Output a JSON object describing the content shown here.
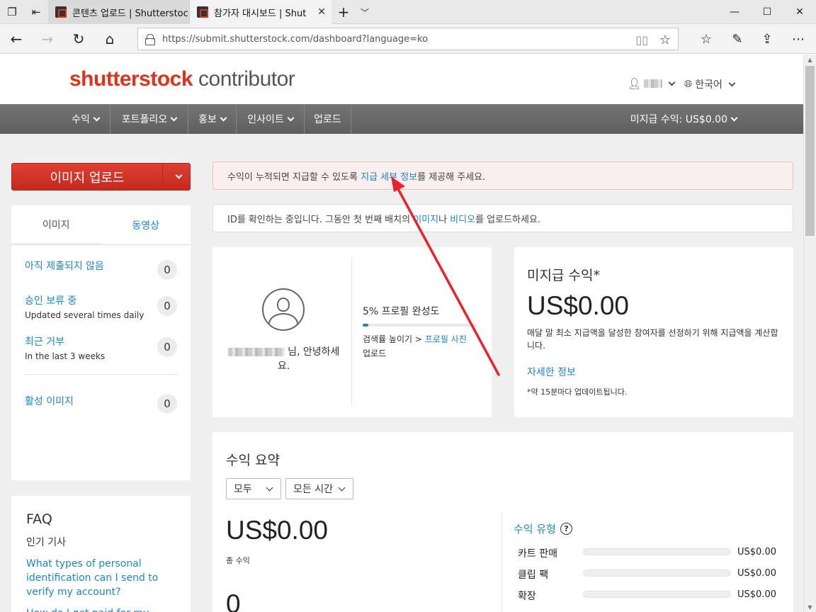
{
  "browser": {
    "tabs": [
      {
        "title": "콘텐츠 업로드 | Shutterstoc",
        "active": false
      },
      {
        "title": "참가자 대시보드 | Shut",
        "active": true
      }
    ],
    "url": "https://submit.shutterstock.com/dashboard?language=ko"
  },
  "header": {
    "logo_brand": "shutterstock",
    "logo_sub": "contributor",
    "language": "한국어"
  },
  "nav": {
    "items": [
      "수익",
      "포트폴리오",
      "홍보",
      "인사이트",
      "업로드"
    ],
    "unpaid": "미지급 수익: US$0.00"
  },
  "upload_button": "이미지 업로드",
  "left_card": {
    "tabs": [
      "이미지",
      "동영상"
    ],
    "rows": [
      {
        "title": "아직 제출되지 않음",
        "subtitle": "",
        "count": "0"
      },
      {
        "title": "승인 보류 중",
        "subtitle": "Updated several times daily",
        "count": "0"
      },
      {
        "title": "최근 거부",
        "subtitle": "In the last 3 weeks",
        "count": "0"
      },
      {
        "title": "활성 이미지",
        "subtitle": "",
        "count": "0"
      }
    ]
  },
  "faq": {
    "title": "FAQ",
    "subtitle": "인기 기사",
    "links": [
      "What types of personal identification can I send to verify my account?",
      "How do I get paid for my work?"
    ]
  },
  "alerts": {
    "payment_pre": "수익이 누적되면 지급할 수 있도록 ",
    "payment_link": "지급 세부 정보",
    "payment_post": "를 제공해 주세요.",
    "id_pre": "ID를 확인하는 중입니다. 그동안 첫 번째 배치의 ",
    "id_link1": "이미지",
    "id_mid": "나 ",
    "id_link2": "비디오",
    "id_post": "를 업로드하세요."
  },
  "profile": {
    "greeting": "님, 안녕하세요.",
    "completion_title": "5% 프로필 완성도",
    "completion_pct": 5,
    "hint_pre": "검색률 높이기 > ",
    "hint_link": "프로필 사진",
    "hint_post": "업로드"
  },
  "unpaid_card": {
    "title": "미지급 수익*",
    "amount": "US$0.00",
    "desc": "매달 말 최소 지급액을 달성한 참여자를 선정하기 위해 지급액을 계산합니다.",
    "link": "자세한 정보",
    "note": "*약 15분마다 업데이트됩니다."
  },
  "earnings": {
    "title": "수익 요약",
    "filter_type": "모두",
    "filter_time": "모든 시간",
    "total": "US$0.00",
    "total_label": "총 수익",
    "count": "0",
    "types_title": "수익 유형",
    "types": [
      {
        "name": "카트 판매",
        "amount": "US$0.00",
        "fraction": 0
      },
      {
        "name": "클립 팩",
        "amount": "US$0.00",
        "fraction": 0
      },
      {
        "name": "확장",
        "amount": "US$0.00",
        "fraction": 0
      }
    ]
  },
  "colors": {
    "brand": "#e0301e",
    "link": "#1d86c8",
    "nav": "#6d6d6d",
    "annotation": "#e8242a"
  }
}
